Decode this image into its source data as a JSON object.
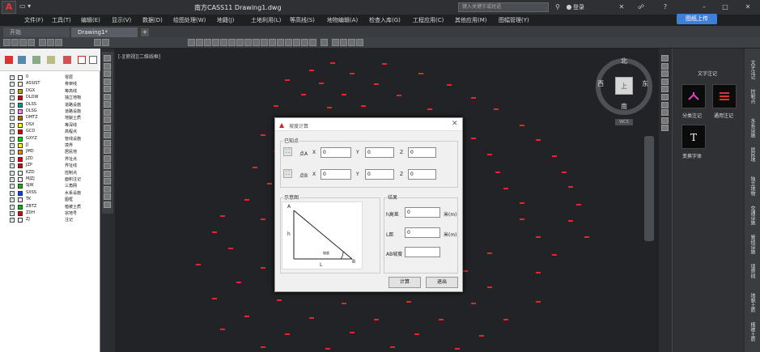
{
  "app": {
    "title": "南方CASS11    Drawing1.dwg",
    "logo": "A",
    "qat": "▭ ▾",
    "search_placeholder": "键入关键字或短语",
    "login": "登录",
    "upload": "图纸上传"
  },
  "menu": [
    "文件(F)",
    "工具(T)",
    "编辑(E)",
    "显示(V)",
    "数据(D)",
    "绘图处理(W)",
    "地籍(J)",
    "土地利用(L)",
    "等高线(S)",
    "地物编辑(A)",
    "检查入库(G)",
    "工程应用(C)",
    "其他应用(M)",
    "图幅管理(Y)"
  ],
  "tabs": {
    "start": "开始",
    "drawing": "Drawing1*",
    "add": "+"
  },
  "viewport_label": "[-][俯视][二维线框]",
  "compass": {
    "north": "北",
    "south": "南",
    "east": "东",
    "west": "西",
    "top": "上",
    "wcs": "WCS"
  },
  "layers": [
    {
      "name": "0",
      "desc": "零层",
      "color": "#ffffff"
    },
    {
      "name": "ASSIST",
      "desc": "骨架线",
      "color": "#ffffff"
    },
    {
      "name": "DGX",
      "desc": "等高线",
      "color": "#c8a000"
    },
    {
      "name": "DLDW",
      "desc": "独立地物",
      "color": "#e00000"
    },
    {
      "name": "DLSS",
      "desc": "道路设施",
      "color": "#00a0a0"
    },
    {
      "name": "DLSG",
      "desc": "道路设施",
      "color": "#ff80ff"
    },
    {
      "name": "DMTZ",
      "desc": "地貌土质",
      "color": "#c86400"
    },
    {
      "name": "DSX",
      "desc": "等深线",
      "color": "#ffff00"
    },
    {
      "name": "GCD",
      "desc": "高程点",
      "color": "#e00000"
    },
    {
      "name": "GXYZ",
      "desc": "管线设施",
      "color": "#00e000"
    },
    {
      "name": "JJ",
      "desc": "境界",
      "color": "#ffff00"
    },
    {
      "name": "JMD",
      "desc": "居民地",
      "color": "#ff8000"
    },
    {
      "name": "JZD",
      "desc": "界址点",
      "color": "#e00000"
    },
    {
      "name": "JZP",
      "desc": "界址线",
      "color": "#e00000"
    },
    {
      "name": "KZD",
      "desc": "控制点",
      "color": "#ffffff"
    },
    {
      "name": "MJZJ",
      "desc": "面积注记",
      "color": "#ffffff"
    },
    {
      "name": "SJW",
      "desc": "三角网",
      "color": "#00c000"
    },
    {
      "name": "SXSS",
      "desc": "水系设施",
      "color": "#0040ff"
    },
    {
      "name": "TK",
      "desc": "图框",
      "color": "#ffffff"
    },
    {
      "name": "ZBTZ",
      "desc": "植被土质",
      "color": "#00c000"
    },
    {
      "name": "ZDH",
      "desc": "宗地号",
      "color": "#e00000"
    },
    {
      "name": "ZJ",
      "desc": "注记",
      "color": "#ffffff"
    }
  ],
  "right_panel": {
    "title": "文字注记",
    "items": [
      "分类注记",
      "通用注记",
      "变换字体"
    ],
    "vtabs": [
      "文字注记",
      "控制点",
      "水系设施",
      "居民地",
      "独立地物",
      "交通设施",
      "管线设施",
      "境界线",
      "地貌土质",
      "植被土质"
    ]
  },
  "dialog": {
    "title": "坡度计算",
    "known_points": "已知点",
    "point_a": "点A",
    "point_b": "点B",
    "x": "X",
    "y": "Y",
    "z": "Z",
    "a_x": "0",
    "a_y": "0",
    "a_z": "0",
    "b_x": "0",
    "b_y": "0",
    "b_z": "0",
    "diagram_group": "示意图",
    "result_group": "结果",
    "h_label": "h高差",
    "h_value": "0",
    "l_label": "L距",
    "l_value": "0",
    "unit": "米(m)",
    "slope_label": "AB坡度",
    "slope_value": "",
    "calc": "计算",
    "exit": "退出",
    "diagram": {
      "a": "A",
      "b": "B",
      "h": "h",
      "l": "L",
      "angle": "坡度"
    }
  }
}
